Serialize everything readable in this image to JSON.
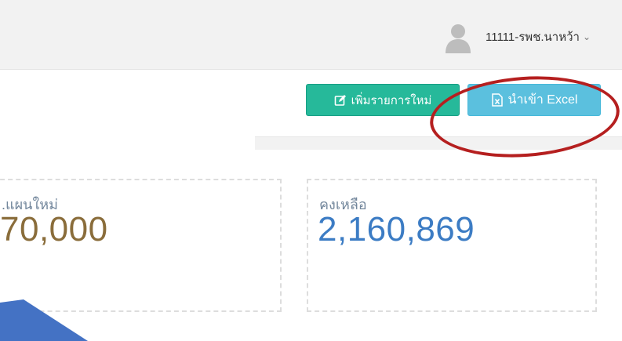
{
  "header": {
    "user_name": "11111-รพช.นาหว้า",
    "caret": "⌄"
  },
  "toolbar": {
    "add_label": "เพิ่มรายการใหม่",
    "import_label": "นำเข้า Excel"
  },
  "summary": {
    "planned_label": ".แผนใหม่",
    "planned_value": "70,000",
    "remaining_label": "คงเหลือ",
    "remaining_value": "2,160,869"
  },
  "colors": {
    "add_button": "#26b99a",
    "import_button": "#5bc0de",
    "highlight_circle": "#b51f1f",
    "planned_value": "#8a6d3b",
    "remaining_value": "#3c7cc4",
    "decoration": "#4472c4"
  },
  "icons": {
    "avatar": "user-avatar-icon",
    "add": "edit-icon",
    "import": "excel-file-icon"
  }
}
